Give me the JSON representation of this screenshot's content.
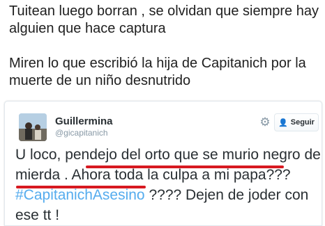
{
  "caption": {
    "line1": "Tuitean luego borran , se olvidan que siempre hay alguien que hace captura",
    "line2": "Miren lo que escribió la hija de Capitanich por la muerte de un niño desnutrido"
  },
  "tweet": {
    "name": "Guillermina",
    "handle": "@gicapitanich",
    "follow_label": "Seguir",
    "text_part1": "U loco, ",
    "text_underlined_1": "pendejo del orto que se murio",
    "text_underlined_2": "negro de mierda",
    "text_part2": " . Ahora toda la culpa a mi papa??? ",
    "hashtag": "#CapitanichAsesino",
    "text_part3": " ???? Dejen de joder con ese tt !"
  },
  "icons": {
    "settings": "gear-icon",
    "follow": "add-user-icon"
  },
  "colors": {
    "hashtag": "#55acee",
    "underline": "#d71920",
    "name": "#292f33",
    "handle": "#8899a6"
  }
}
